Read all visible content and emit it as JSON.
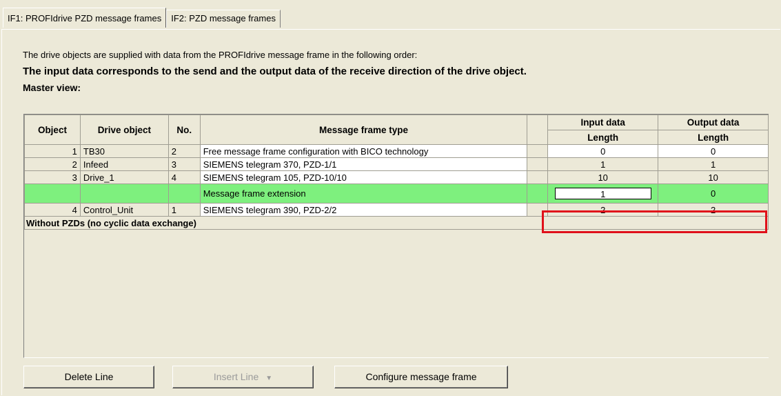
{
  "tabs": [
    {
      "label": "IF1:  PROFIdrive  PZD message frames"
    },
    {
      "label": "IF2:  PZD message frames"
    }
  ],
  "description": {
    "line1": "The drive objects are supplied with data from the PROFIdrive message frame in the following order:",
    "line2": "The input data corresponds to the send and the output data of the receive direction of the drive object.",
    "line3": "Master view:"
  },
  "table": {
    "headers": {
      "object": "Object",
      "drive_object": "Drive object",
      "no": "No.",
      "message_frame_type": "Message frame type",
      "input_data": "Input data",
      "output_data": "Output data",
      "input_length": "Length",
      "output_length": "Length"
    },
    "rows": [
      {
        "object": "1",
        "drive_object": "TB30",
        "no": "2",
        "type": "Free message frame configuration with BICO technology",
        "input": "0",
        "output": "0"
      },
      {
        "object": "2",
        "drive_object": "Infeed",
        "no": "3",
        "type": "SIEMENS telegram 370, PZD-1/1",
        "input": "1",
        "output": "1"
      },
      {
        "object": "3",
        "drive_object": "Drive_1",
        "no": "4",
        "type": "SIEMENS telegram 105, PZD-10/10",
        "input": "10",
        "output": "10"
      },
      {
        "object": "",
        "drive_object": "",
        "no": "",
        "type": "Message frame extension",
        "input": "1",
        "output": "0"
      },
      {
        "object": "4",
        "drive_object": "Control_Unit",
        "no": "1",
        "type": "SIEMENS telegram 390, PZD-2/2",
        "input": "2",
        "output": "2"
      }
    ],
    "footer": "Without PZDs (no cyclic data exchange)"
  },
  "buttons": {
    "delete_line": "Delete Line",
    "insert_line": "Insert Line",
    "configure": "Configure message frame"
  },
  "colors": {
    "highlight_row": "#7ef07e",
    "selection_outline": "#e0101a"
  }
}
